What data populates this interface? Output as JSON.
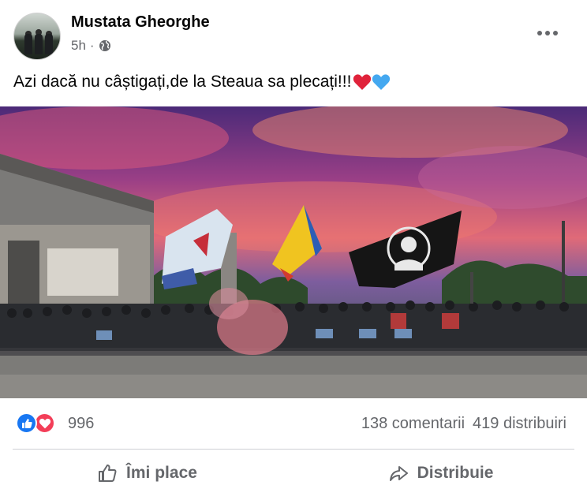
{
  "post": {
    "author": "Mustata Gheorghe",
    "time": "5h",
    "separator": "·",
    "privacy_icon": "globe-icon",
    "more_icon": "more-options-icon",
    "caption": "Azi dacă nu câștigați,de la Steaua sa plecați!!!",
    "caption_emojis": [
      "red-heart-icon",
      "blue-heart-icon"
    ]
  },
  "reactions": {
    "icons": [
      "like-icon",
      "love-icon"
    ],
    "count": "996",
    "comments": "138 comentarii",
    "shares": "419 distribuiri"
  },
  "actions": {
    "like_label": "Îmi place",
    "like_icon": "thumbs-up-icon",
    "share_label": "Distribuie",
    "share_icon": "share-arrow-icon"
  },
  "colors": {
    "like_blue": "#1877f2",
    "love_red": "#f33e58",
    "secondary_text": "#65676b"
  }
}
